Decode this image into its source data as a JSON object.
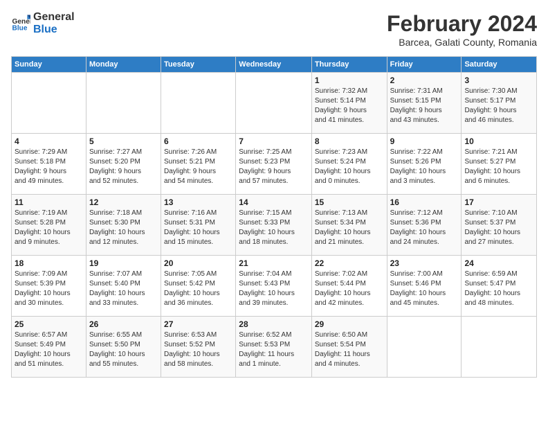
{
  "header": {
    "logo_general": "General",
    "logo_blue": "Blue",
    "month": "February 2024",
    "location": "Barcea, Galati County, Romania"
  },
  "weekdays": [
    "Sunday",
    "Monday",
    "Tuesday",
    "Wednesday",
    "Thursday",
    "Friday",
    "Saturday"
  ],
  "weeks": [
    [
      {
        "day": "",
        "info": ""
      },
      {
        "day": "",
        "info": ""
      },
      {
        "day": "",
        "info": ""
      },
      {
        "day": "",
        "info": ""
      },
      {
        "day": "1",
        "info": "Sunrise: 7:32 AM\nSunset: 5:14 PM\nDaylight: 9 hours\nand 41 minutes."
      },
      {
        "day": "2",
        "info": "Sunrise: 7:31 AM\nSunset: 5:15 PM\nDaylight: 9 hours\nand 43 minutes."
      },
      {
        "day": "3",
        "info": "Sunrise: 7:30 AM\nSunset: 5:17 PM\nDaylight: 9 hours\nand 46 minutes."
      }
    ],
    [
      {
        "day": "4",
        "info": "Sunrise: 7:29 AM\nSunset: 5:18 PM\nDaylight: 9 hours\nand 49 minutes."
      },
      {
        "day": "5",
        "info": "Sunrise: 7:27 AM\nSunset: 5:20 PM\nDaylight: 9 hours\nand 52 minutes."
      },
      {
        "day": "6",
        "info": "Sunrise: 7:26 AM\nSunset: 5:21 PM\nDaylight: 9 hours\nand 54 minutes."
      },
      {
        "day": "7",
        "info": "Sunrise: 7:25 AM\nSunset: 5:23 PM\nDaylight: 9 hours\nand 57 minutes."
      },
      {
        "day": "8",
        "info": "Sunrise: 7:23 AM\nSunset: 5:24 PM\nDaylight: 10 hours\nand 0 minutes."
      },
      {
        "day": "9",
        "info": "Sunrise: 7:22 AM\nSunset: 5:26 PM\nDaylight: 10 hours\nand 3 minutes."
      },
      {
        "day": "10",
        "info": "Sunrise: 7:21 AM\nSunset: 5:27 PM\nDaylight: 10 hours\nand 6 minutes."
      }
    ],
    [
      {
        "day": "11",
        "info": "Sunrise: 7:19 AM\nSunset: 5:28 PM\nDaylight: 10 hours\nand 9 minutes."
      },
      {
        "day": "12",
        "info": "Sunrise: 7:18 AM\nSunset: 5:30 PM\nDaylight: 10 hours\nand 12 minutes."
      },
      {
        "day": "13",
        "info": "Sunrise: 7:16 AM\nSunset: 5:31 PM\nDaylight: 10 hours\nand 15 minutes."
      },
      {
        "day": "14",
        "info": "Sunrise: 7:15 AM\nSunset: 5:33 PM\nDaylight: 10 hours\nand 18 minutes."
      },
      {
        "day": "15",
        "info": "Sunrise: 7:13 AM\nSunset: 5:34 PM\nDaylight: 10 hours\nand 21 minutes."
      },
      {
        "day": "16",
        "info": "Sunrise: 7:12 AM\nSunset: 5:36 PM\nDaylight: 10 hours\nand 24 minutes."
      },
      {
        "day": "17",
        "info": "Sunrise: 7:10 AM\nSunset: 5:37 PM\nDaylight: 10 hours\nand 27 minutes."
      }
    ],
    [
      {
        "day": "18",
        "info": "Sunrise: 7:09 AM\nSunset: 5:39 PM\nDaylight: 10 hours\nand 30 minutes."
      },
      {
        "day": "19",
        "info": "Sunrise: 7:07 AM\nSunset: 5:40 PM\nDaylight: 10 hours\nand 33 minutes."
      },
      {
        "day": "20",
        "info": "Sunrise: 7:05 AM\nSunset: 5:42 PM\nDaylight: 10 hours\nand 36 minutes."
      },
      {
        "day": "21",
        "info": "Sunrise: 7:04 AM\nSunset: 5:43 PM\nDaylight: 10 hours\nand 39 minutes."
      },
      {
        "day": "22",
        "info": "Sunrise: 7:02 AM\nSunset: 5:44 PM\nDaylight: 10 hours\nand 42 minutes."
      },
      {
        "day": "23",
        "info": "Sunrise: 7:00 AM\nSunset: 5:46 PM\nDaylight: 10 hours\nand 45 minutes."
      },
      {
        "day": "24",
        "info": "Sunrise: 6:59 AM\nSunset: 5:47 PM\nDaylight: 10 hours\nand 48 minutes."
      }
    ],
    [
      {
        "day": "25",
        "info": "Sunrise: 6:57 AM\nSunset: 5:49 PM\nDaylight: 10 hours\nand 51 minutes."
      },
      {
        "day": "26",
        "info": "Sunrise: 6:55 AM\nSunset: 5:50 PM\nDaylight: 10 hours\nand 55 minutes."
      },
      {
        "day": "27",
        "info": "Sunrise: 6:53 AM\nSunset: 5:52 PM\nDaylight: 10 hours\nand 58 minutes."
      },
      {
        "day": "28",
        "info": "Sunrise: 6:52 AM\nSunset: 5:53 PM\nDaylight: 11 hours\nand 1 minute."
      },
      {
        "day": "29",
        "info": "Sunrise: 6:50 AM\nSunset: 5:54 PM\nDaylight: 11 hours\nand 4 minutes."
      },
      {
        "day": "",
        "info": ""
      },
      {
        "day": "",
        "info": ""
      }
    ]
  ]
}
